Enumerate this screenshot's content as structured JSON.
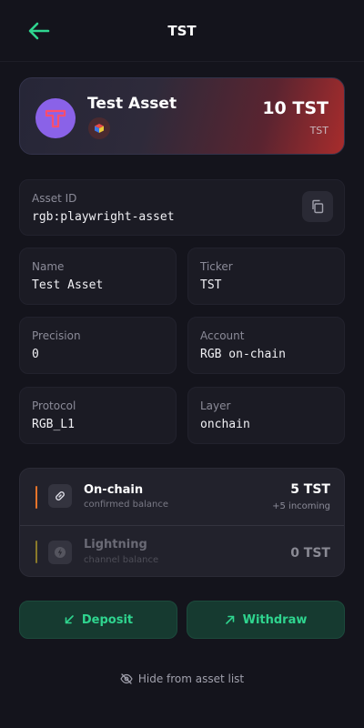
{
  "header": {
    "title": "TST"
  },
  "asset": {
    "name": "Test Asset",
    "amount": "10 TST",
    "ticker": "TST"
  },
  "details": {
    "asset_id": {
      "label": "Asset ID",
      "value": "rgb:playwright-asset"
    },
    "name": {
      "label": "Name",
      "value": "Test Asset"
    },
    "ticker": {
      "label": "Ticker",
      "value": "TST"
    },
    "precision": {
      "label": "Precision",
      "value": "0"
    },
    "account": {
      "label": "Account",
      "value": "RGB on-chain"
    },
    "protocol": {
      "label": "Protocol",
      "value": "RGB_L1"
    },
    "layer": {
      "label": "Layer",
      "value": "onchain"
    }
  },
  "balances": {
    "onchain": {
      "title": "On-chain",
      "subtitle": "confirmed balance",
      "amount": "5 TST",
      "incoming": "+5 incoming",
      "accent": "#e8742a"
    },
    "lightning": {
      "title": "Lightning",
      "subtitle": "channel balance",
      "amount": "0 TST",
      "accent": "#8a7a2a"
    }
  },
  "actions": {
    "deposit": "Deposit",
    "withdraw": "Withdraw",
    "hide": "Hide from asset list"
  },
  "colors": {
    "accent_green": "#2fd58f",
    "background": "#14141c",
    "asset_logo": "#8a62e8"
  },
  "icons": {
    "back": "arrow-left-icon",
    "copy": "copy-icon",
    "onchain": "link-icon",
    "lightning": "lightning-icon",
    "deposit": "arrow-down-left-icon",
    "withdraw": "arrow-up-right-icon",
    "hide": "eye-off-icon"
  }
}
